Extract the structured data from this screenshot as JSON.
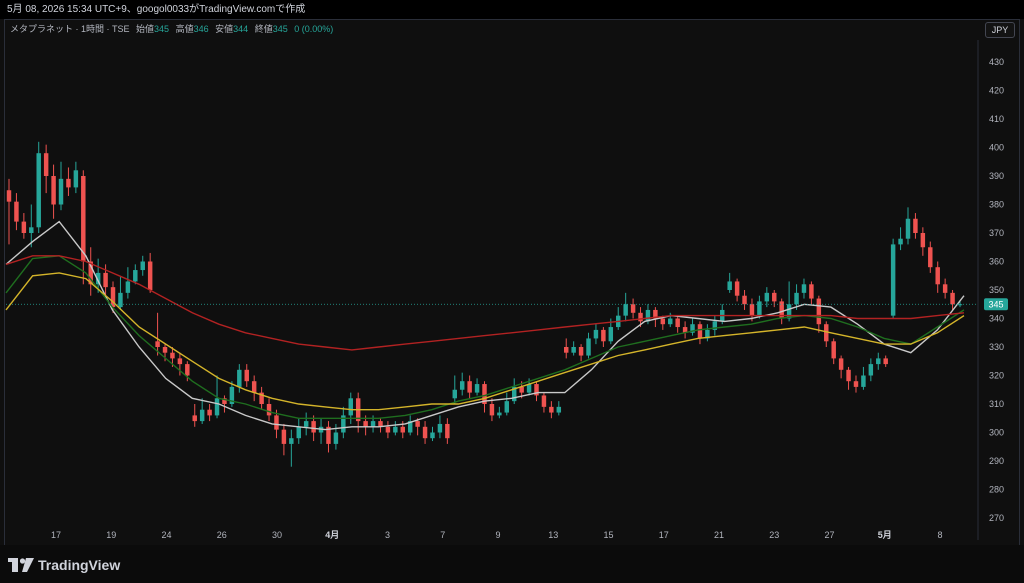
{
  "header": {
    "caption": "5月 08, 2026 15:34 UTC+9、googol0033がTradingView.comで作成"
  },
  "legend": {
    "symbol": "メタプラネット · 1時間 · TSE",
    "open_label": "始値",
    "open": "345",
    "high_label": "高値",
    "high": "346",
    "low_label": "安値",
    "low": "344",
    "close_label": "終値",
    "close": "345",
    "change": "0 (0.00%)"
  },
  "currency_button": "JPY",
  "last_price_tag": "345",
  "brand": {
    "name": "TradingView"
  },
  "colors": {
    "background": "#0f0f0f",
    "up": "#26a69a",
    "down": "#ef5350",
    "ma_white": "#c9c9c9",
    "ma_green": "#1f6e1f",
    "ma_yellow": "#d4b42a",
    "ma_red": "#b22222",
    "price_line": "#26a69a"
  },
  "chart_data": {
    "type": "candlestick",
    "y_ticks": [
      "270",
      "280",
      "290",
      "300",
      "310",
      "320",
      "330",
      "340",
      "350",
      "360",
      "370",
      "380",
      "390",
      "400",
      "410",
      "420",
      "430"
    ],
    "ylim": [
      266,
      438
    ],
    "x_ticks": [
      "17",
      "19",
      "24",
      "26",
      "30",
      "4月",
      "3",
      "7",
      "9",
      "13",
      "15",
      "17",
      "21",
      "23",
      "27",
      "5月",
      "8"
    ],
    "grid": false,
    "last_price": 345,
    "candles": [
      [
        385,
        381,
        389,
        366
      ],
      [
        381,
        374,
        384,
        371
      ],
      [
        374,
        370,
        377,
        368
      ],
      [
        370,
        372,
        380,
        365
      ],
      [
        372,
        398,
        402,
        370
      ],
      [
        398,
        390,
        401,
        384
      ],
      [
        390,
        380,
        394,
        375
      ],
      [
        380,
        389,
        395,
        378
      ],
      [
        389,
        386,
        393,
        383
      ],
      [
        386,
        392,
        395,
        384
      ],
      [
        390,
        360,
        392,
        352
      ],
      [
        360,
        352,
        365,
        348
      ],
      [
        352,
        356,
        361,
        349
      ],
      [
        356,
        351,
        359,
        347
      ],
      [
        351,
        344,
        353,
        342
      ],
      [
        344,
        349,
        355,
        343
      ],
      [
        349,
        353,
        358,
        347
      ],
      [
        353,
        357,
        359,
        352
      ],
      [
        357,
        360,
        362,
        355
      ],
      [
        360,
        350,
        363,
        349
      ],
      [
        332,
        330,
        342,
        327
      ],
      [
        330,
        328,
        331,
        325
      ],
      [
        328,
        326,
        330,
        323
      ],
      [
        326,
        324,
        328,
        320
      ],
      [
        324,
        320,
        325,
        318
      ],
      [
        306,
        304,
        310,
        302
      ],
      [
        304,
        308,
        312,
        303
      ],
      [
        308,
        306,
        310,
        304
      ],
      [
        306,
        312,
        320,
        305
      ],
      [
        312,
        310,
        313,
        307
      ],
      [
        310,
        316,
        318,
        309
      ],
      [
        316,
        322,
        324,
        314
      ],
      [
        322,
        318,
        324,
        316
      ],
      [
        318,
        314,
        320,
        311
      ],
      [
        314,
        310,
        316,
        308
      ],
      [
        310,
        306,
        312,
        304
      ],
      [
        306,
        301,
        308,
        298
      ],
      [
        301,
        296,
        303,
        292
      ],
      [
        296,
        298,
        301,
        288
      ],
      [
        298,
        302,
        305,
        296
      ],
      [
        302,
        304,
        307,
        299
      ],
      [
        304,
        300,
        306,
        297
      ],
      [
        300,
        302,
        305,
        296
      ],
      [
        302,
        296,
        304,
        293
      ],
      [
        296,
        300,
        303,
        294
      ],
      [
        300,
        306,
        309,
        298
      ],
      [
        306,
        312,
        314,
        303
      ],
      [
        312,
        304,
        314,
        300
      ],
      [
        304,
        302,
        306,
        299
      ],
      [
        302,
        304,
        306,
        300
      ],
      [
        304,
        302,
        305,
        300
      ],
      [
        302,
        300,
        304,
        298
      ],
      [
        300,
        302,
        304,
        299
      ],
      [
        302,
        300,
        304,
        298
      ],
      [
        300,
        304,
        306,
        299
      ],
      [
        304,
        302,
        305,
        299
      ],
      [
        302,
        298,
        304,
        296
      ],
      [
        298,
        300,
        302,
        297
      ],
      [
        300,
        303,
        306,
        298
      ],
      [
        303,
        298,
        305,
        296
      ],
      [
        312,
        315,
        320,
        310
      ],
      [
        315,
        318,
        321,
        313
      ],
      [
        318,
        314,
        320,
        312
      ],
      [
        314,
        317,
        319,
        313
      ],
      [
        317,
        310,
        318,
        307
      ],
      [
        310,
        306,
        312,
        304
      ],
      [
        306,
        307,
        309,
        305
      ],
      [
        307,
        311,
        314,
        306
      ],
      [
        311,
        316,
        319,
        310
      ],
      [
        316,
        314,
        318,
        312
      ],
      [
        314,
        317,
        319,
        313
      ],
      [
        317,
        313,
        318,
        311
      ],
      [
        313,
        309,
        314,
        307
      ],
      [
        309,
        307,
        311,
        305
      ],
      [
        307,
        309,
        311,
        306
      ],
      [
        330,
        328,
        333,
        326
      ],
      [
        328,
        330,
        332,
        327
      ],
      [
        330,
        327,
        331,
        325
      ],
      [
        327,
        333,
        335,
        326
      ],
      [
        333,
        336,
        338,
        331
      ],
      [
        336,
        332,
        337,
        330
      ],
      [
        332,
        337,
        340,
        331
      ],
      [
        337,
        341,
        344,
        336
      ],
      [
        341,
        345,
        349,
        339
      ],
      [
        345,
        342,
        347,
        340
      ],
      [
        342,
        339,
        344,
        337
      ],
      [
        339,
        343,
        345,
        338
      ],
      [
        343,
        340,
        344,
        337
      ],
      [
        340,
        338,
        341,
        336
      ],
      [
        338,
        340,
        342,
        337
      ],
      [
        340,
        337,
        341,
        335
      ],
      [
        337,
        335,
        339,
        333
      ],
      [
        335,
        338,
        340,
        334
      ],
      [
        338,
        333,
        339,
        331
      ],
      [
        333,
        336,
        338,
        332
      ],
      [
        336,
        339,
        341,
        334
      ],
      [
        339,
        343,
        345,
        338
      ],
      [
        350,
        353,
        356,
        349
      ],
      [
        353,
        348,
        354,
        346
      ],
      [
        348,
        345,
        350,
        343
      ],
      [
        345,
        341,
        347,
        339
      ],
      [
        341,
        346,
        348,
        340
      ],
      [
        346,
        349,
        351,
        344
      ],
      [
        349,
        346,
        350,
        344
      ],
      [
        346,
        340,
        347,
        338
      ],
      [
        340,
        345,
        353,
        339
      ],
      [
        345,
        349,
        352,
        343
      ],
      [
        349,
        352,
        354,
        347
      ],
      [
        352,
        347,
        353,
        345
      ],
      [
        347,
        338,
        348,
        335
      ],
      [
        338,
        332,
        339,
        330
      ],
      [
        332,
        326,
        333,
        324
      ],
      [
        326,
        322,
        327,
        319
      ],
      [
        322,
        318,
        323,
        315
      ],
      [
        318,
        316,
        320,
        314
      ],
      [
        316,
        320,
        323,
        315
      ],
      [
        320,
        324,
        326,
        318
      ],
      [
        324,
        326,
        328,
        322
      ],
      [
        326,
        324,
        327,
        323
      ],
      [
        341,
        366,
        368,
        340
      ],
      [
        366,
        368,
        372,
        364
      ],
      [
        368,
        375,
        379,
        366
      ],
      [
        375,
        370,
        377,
        368
      ],
      [
        370,
        365,
        372,
        362
      ],
      [
        365,
        358,
        367,
        356
      ],
      [
        358,
        352,
        360,
        349
      ],
      [
        352,
        349,
        354,
        347
      ],
      [
        349,
        345,
        350,
        343
      ],
      [
        345,
        345,
        346,
        344
      ]
    ],
    "moving_averages": [
      {
        "color_key": "ma_white",
        "values": [
          359,
          367,
          374,
          362,
          343,
          330,
          319,
          312,
          310,
          306,
          303,
          302,
          301,
          302,
          302,
          303,
          306,
          309,
          311,
          312,
          314,
          314,
          322,
          332,
          339,
          341,
          340,
          339,
          340,
          342,
          345,
          344,
          338,
          331,
          328,
          336,
          348
        ]
      },
      {
        "color_key": "ma_green",
        "values": [
          349,
          361,
          362,
          356,
          344,
          334,
          326,
          318,
          312,
          310,
          307,
          305,
          305,
          305,
          305,
          306,
          308,
          311,
          313,
          316,
          319,
          322,
          326,
          330,
          332,
          334,
          336,
          337,
          338,
          340,
          341,
          340,
          337,
          333,
          331,
          337,
          343
        ]
      },
      {
        "color_key": "ma_yellow",
        "values": [
          343,
          355,
          356,
          354,
          346,
          337,
          331,
          325,
          319,
          315,
          312,
          310,
          309,
          308,
          308,
          309,
          310,
          310,
          312,
          315,
          318,
          321,
          324,
          327,
          329,
          331,
          333,
          334,
          335,
          336,
          337,
          335,
          333,
          331,
          331,
          335,
          341
        ]
      },
      {
        "color_key": "ma_red",
        "values": [
          359,
          362,
          362,
          360,
          356,
          352,
          347,
          342,
          338,
          335,
          333,
          331,
          330,
          329,
          330,
          331,
          332,
          333,
          334,
          335,
          336,
          337,
          338,
          339,
          340,
          341,
          341,
          341,
          341,
          341,
          341,
          341,
          340,
          340,
          340,
          341,
          342
        ]
      }
    ]
  }
}
